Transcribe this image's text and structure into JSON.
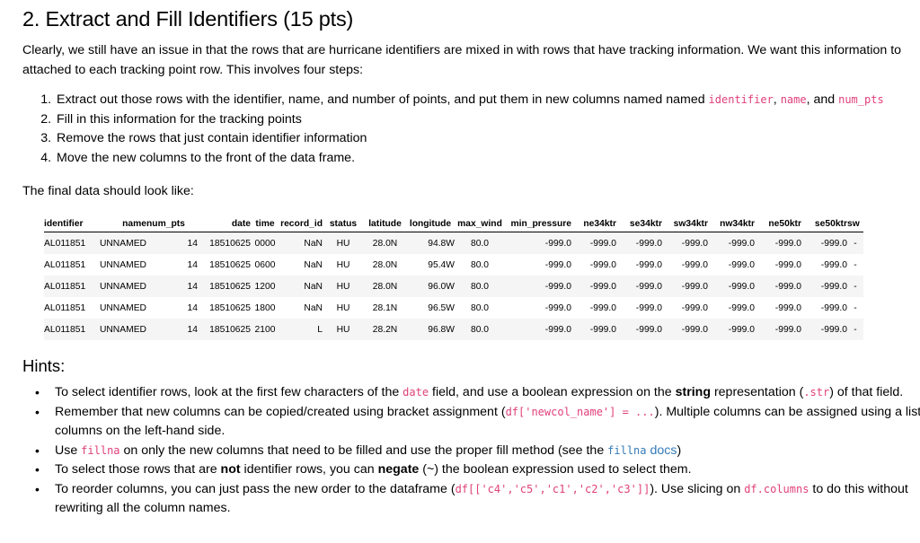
{
  "title": "2. Extract and Fill Identifiers (15 pts)",
  "intro": {
    "text": "Clearly, we still have an issue in that the rows that are hurricane identifiers are mixed in with rows that have tracking information. We want this information to attached to each tracking point row. This involves four steps:"
  },
  "steps": {
    "s1_pre": "Extract out those rows with the identifier, name, and number of points, and put them in new columns named named ",
    "s1_code1": "identifier",
    "s1_sep1": ", ",
    "s1_code2": "name",
    "s1_sep2": ", and ",
    "s1_code3": "num_pts",
    "s2": "Fill in this information for the tracking points",
    "s3": "Remove the rows that just contain identifier information",
    "s4": "Move the new columns to the front of the data frame."
  },
  "final_label": "The final data should look like:",
  "table": {
    "headers": [
      "identifier",
      "name",
      "num_pts",
      "date",
      "time",
      "record_id",
      "status",
      "latitude",
      "longitude",
      "max_wind",
      "min_pressure",
      "ne34ktr",
      "se34ktr",
      "sw34ktr",
      "nw34ktr",
      "ne50ktr",
      "se50ktr",
      "sw"
    ],
    "rows": [
      [
        "AL011851",
        "UNNAMED",
        "14",
        "18510625",
        "0000",
        "NaN",
        "HU",
        "28.0N",
        "94.8W",
        "80.0",
        "-999.0",
        "-999.0",
        "-999.0",
        "-999.0",
        "-999.0",
        "-999.0",
        "-999.0",
        "-"
      ],
      [
        "AL011851",
        "UNNAMED",
        "14",
        "18510625",
        "0600",
        "NaN",
        "HU",
        "28.0N",
        "95.4W",
        "80.0",
        "-999.0",
        "-999.0",
        "-999.0",
        "-999.0",
        "-999.0",
        "-999.0",
        "-999.0",
        "-"
      ],
      [
        "AL011851",
        "UNNAMED",
        "14",
        "18510625",
        "1200",
        "NaN",
        "HU",
        "28.0N",
        "96.0W",
        "80.0",
        "-999.0",
        "-999.0",
        "-999.0",
        "-999.0",
        "-999.0",
        "-999.0",
        "-999.0",
        "-"
      ],
      [
        "AL011851",
        "UNNAMED",
        "14",
        "18510625",
        "1800",
        "NaN",
        "HU",
        "28.1N",
        "96.5W",
        "80.0",
        "-999.0",
        "-999.0",
        "-999.0",
        "-999.0",
        "-999.0",
        "-999.0",
        "-999.0",
        "-"
      ],
      [
        "AL011851",
        "UNNAMED",
        "14",
        "18510625",
        "2100",
        "L",
        "HU",
        "28.2N",
        "96.8W",
        "80.0",
        "-999.0",
        "-999.0",
        "-999.0",
        "-999.0",
        "-999.0",
        "-999.0",
        "-999.0",
        "-"
      ]
    ]
  },
  "hints": {
    "title": "Hints:",
    "h1_a": "To select identifier rows, look at the first few characters of the ",
    "h1_code1": "date",
    "h1_b": " field, and use a boolean expression on the ",
    "h1_bold": "string",
    "h1_c": " representation (",
    "h1_code2": ".str",
    "h1_d": ") of that field.",
    "h2_a": "Remember that new columns can be copied/created using bracket assignment (",
    "h2_code": "df['newcol_name'] = ...",
    "h2_b": "). Multiple columns can be assigned using a list of columns on the left-hand side.",
    "h3_a": "Use ",
    "h3_code": "fillna",
    "h3_b": " on only the new columns that need to be filled and use the proper fill method (see the ",
    "h3_link_code": "fillna",
    "h3_link_text": " docs",
    "h3_c": ")",
    "h4_a": "To select those rows that are ",
    "h4_bold1": "not",
    "h4_b": " identifier rows, you can ",
    "h4_bold2": "negate",
    "h4_c": " (~) the boolean expression used to select them.",
    "h5_a": "To reorder columns, you can just pass the new order to the dataframe (",
    "h5_code1": "df[['c4','c5','c1','c2','c3']]",
    "h5_b": "). Use slicing on ",
    "h5_code2": "df.columns",
    "h5_c": " to do this without rewriting all the column names."
  }
}
